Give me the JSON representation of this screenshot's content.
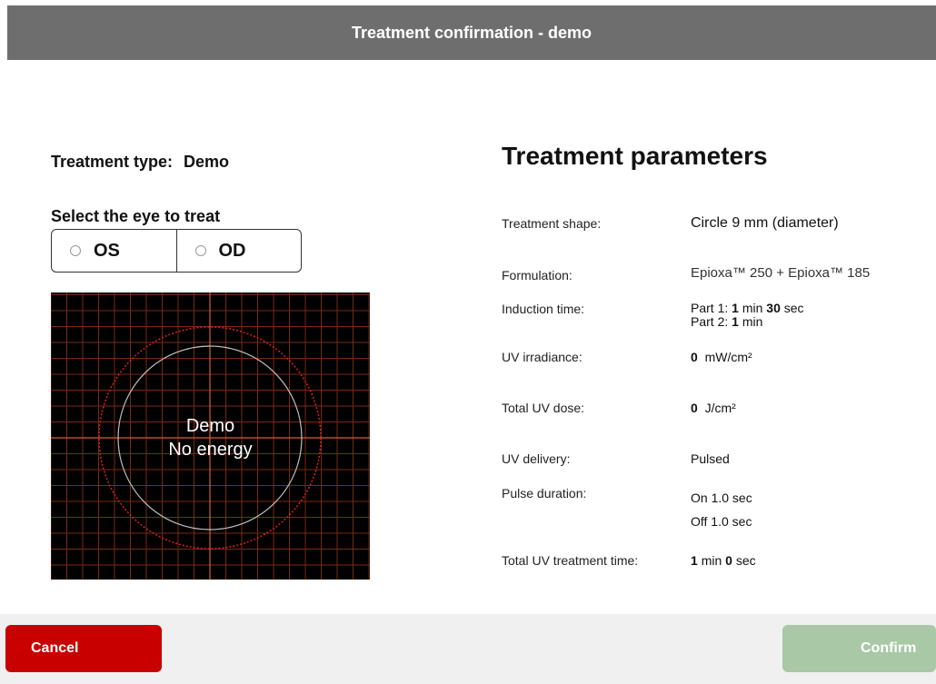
{
  "title": "Treatment confirmation - demo",
  "treatment_type": {
    "label": "Treatment type:",
    "value": "Demo"
  },
  "eye_select": {
    "label": "Select the eye to treat",
    "options": [
      "OS",
      "OD"
    ]
  },
  "preview": {
    "line1": "Demo",
    "line2": "No energy"
  },
  "params": {
    "heading": "Treatment parameters",
    "shape": {
      "label": "Treatment shape:",
      "value": "Circle 9 mm (diameter)"
    },
    "formulation": {
      "label": "Formulation:",
      "value": "Epioxa™ 250 + Epioxa™ 185"
    },
    "induction": {
      "label": "Induction time:",
      "p1_prefix": "Part 1:",
      "p1_min": "1",
      "p1_min_unit": "min",
      "p1_sec": "30",
      "p1_sec_unit": "sec",
      "p2_prefix": "Part 2:",
      "p2_min": "1",
      "p2_min_unit": "min"
    },
    "irradiance": {
      "label": "UV irradiance:",
      "value": "0",
      "unit": "mW/cm²"
    },
    "dose": {
      "label": "Total UV dose:",
      "value": "0",
      "unit": "J/cm²"
    },
    "delivery": {
      "label": "UV delivery:",
      "value": "Pulsed"
    },
    "pulse": {
      "label": "Pulse duration:",
      "on": "On 1.0 sec",
      "off": "Off 1.0 sec"
    },
    "total_time": {
      "label": "Total UV treatment time:",
      "min": "1",
      "min_unit": "min",
      "sec": "0",
      "sec_unit": "sec"
    }
  },
  "buttons": {
    "cancel": "Cancel",
    "confirm": "Confirm"
  },
  "colors": {
    "cancel": "#c80000",
    "confirm_disabled": "#a9c8a6",
    "titlebar": "#6e6e6e"
  }
}
